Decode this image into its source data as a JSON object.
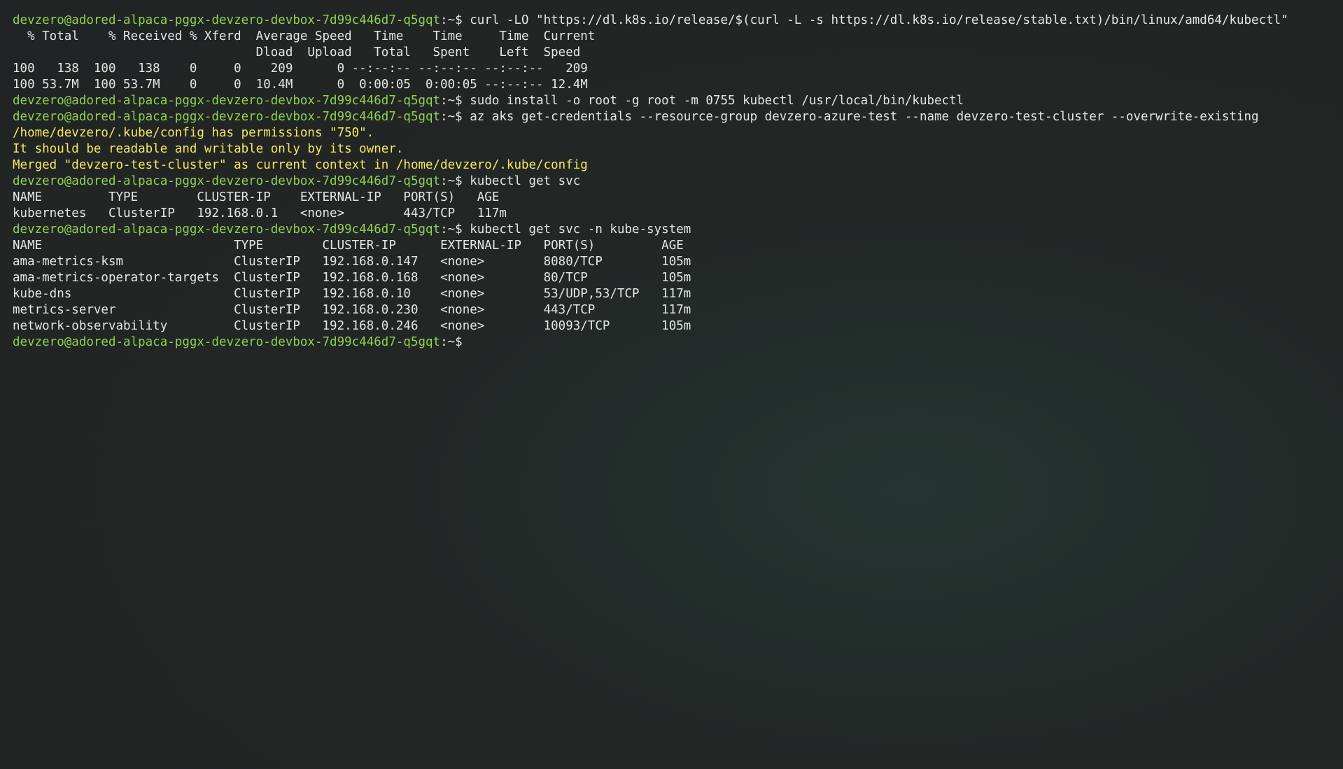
{
  "colors": {
    "background": "#222625",
    "prompt": "#8fd14f",
    "text": "#e4e6e4",
    "warning": "#f3ea5f"
  },
  "prompt": {
    "user_host": "devzero@adored-alpaca-pggx-devzero-devbox-7d99c446d7-q5gqt",
    "suffix": ":~$ "
  },
  "lines": [
    {
      "kind": "cmd",
      "text": "curl -LO \"https://dl.k8s.io/release/$(curl -L -s https://dl.k8s.io/release/stable.txt)/bin/linux/amd64/kubectl\""
    },
    {
      "kind": "out",
      "text": "  % Total    % Received % Xferd  Average Speed   Time    Time     Time  Current"
    },
    {
      "kind": "out",
      "text": "                                 Dload  Upload   Total   Spent    Left  Speed"
    },
    {
      "kind": "out",
      "text": "100   138  100   138    0     0    209      0 --:--:-- --:--:-- --:--:--   209"
    },
    {
      "kind": "out",
      "text": "100 53.7M  100 53.7M    0     0  10.4M      0  0:00:05  0:00:05 --:--:-- 12.4M"
    },
    {
      "kind": "cmd",
      "text": "sudo install -o root -g root -m 0755 kubectl /usr/local/bin/kubectl"
    },
    {
      "kind": "cmd",
      "text": "az aks get-credentials --resource-group devzero-azure-test --name devzero-test-cluster --overwrite-existing"
    },
    {
      "kind": "warn",
      "text": "/home/devzero/.kube/config has permissions \"750\"."
    },
    {
      "kind": "warn",
      "text": "It should be readable and writable only by its owner."
    },
    {
      "kind": "warn",
      "text": "Merged \"devzero-test-cluster\" as current context in /home/devzero/.kube/config"
    },
    {
      "kind": "cmd",
      "text": "kubectl get svc"
    },
    {
      "kind": "out",
      "text": "NAME         TYPE        CLUSTER-IP    EXTERNAL-IP   PORT(S)   AGE"
    },
    {
      "kind": "out",
      "text": "kubernetes   ClusterIP   192.168.0.1   <none>        443/TCP   117m"
    },
    {
      "kind": "cmd",
      "text": "kubectl get svc -n kube-system"
    },
    {
      "kind": "out",
      "text": "NAME                          TYPE        CLUSTER-IP      EXTERNAL-IP   PORT(S)         AGE"
    },
    {
      "kind": "out",
      "text": "ama-metrics-ksm               ClusterIP   192.168.0.147   <none>        8080/TCP        105m"
    },
    {
      "kind": "out",
      "text": "ama-metrics-operator-targets  ClusterIP   192.168.0.168   <none>        80/TCP          105m"
    },
    {
      "kind": "out",
      "text": "kube-dns                      ClusterIP   192.168.0.10    <none>        53/UDP,53/TCP   117m"
    },
    {
      "kind": "out",
      "text": "metrics-server                ClusterIP   192.168.0.230   <none>        443/TCP         117m"
    },
    {
      "kind": "out",
      "text": "network-observability         ClusterIP   192.168.0.246   <none>        10093/TCP       105m"
    },
    {
      "kind": "cmd",
      "text": ""
    }
  ]
}
